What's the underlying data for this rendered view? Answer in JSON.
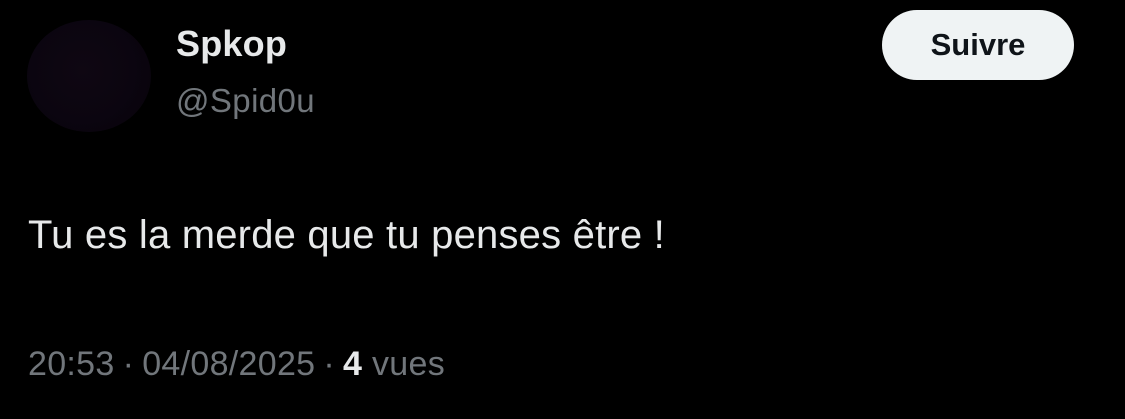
{
  "tweet": {
    "author": {
      "display_name": "Spkop",
      "handle": "@Spid0u"
    },
    "follow_label": "Suivre",
    "text": "Tu es la merde que tu penses être !",
    "meta": {
      "time": "20:53",
      "date": "04/08/2025",
      "separator": "·",
      "views_count": "4",
      "views_label": "vues"
    }
  },
  "colors": {
    "background": "#000000",
    "primary_text": "#e7e9ea",
    "secondary_text": "#71767b",
    "button_bg": "#eff3f4",
    "button_text": "#0f1419"
  }
}
